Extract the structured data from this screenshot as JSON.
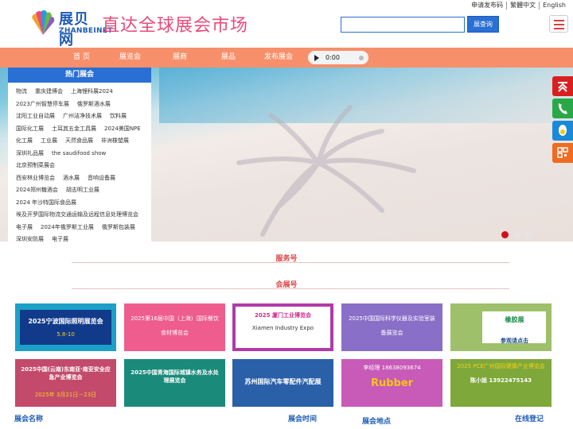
{
  "header": {
    "top_links": [
      "申请发布码",
      "繁體中文",
      "English"
    ],
    "logo_cn": "展贝网",
    "logo_en": "ZHANBEINET",
    "slogan": "直达全球展会市场",
    "search_placeholder": "",
    "search_button": "展查询"
  },
  "nav": {
    "items": [
      "首 页",
      "展览会",
      "展商",
      "展品",
      "发布展会"
    ],
    "audio_time": "0:00"
  },
  "hot_expos": {
    "title": "热门展会",
    "rows": [
      [
        "物流",
        "重庆建博会",
        "上海锂科展2024"
      ],
      [
        "2023广州智慧停车展",
        "俄罗斯酒水展"
      ],
      [
        "沈阳工业自动展",
        "广州洁净技术展",
        "饮料展"
      ],
      [
        "国际化工展",
        "土耳其五金工具展",
        "2024美国NPE"
      ],
      [
        "化工展",
        "工业展",
        "天然食品展",
        "非洲橡塑展"
      ],
      [
        "深圳礼品展",
        "the saudifood show",
        "北京预制菜展会"
      ],
      [
        "西安林业博览会",
        "酒水展",
        "音响设备展"
      ],
      [
        "2024郑州糖酒会",
        "胡志明工业展"
      ],
      [
        "2024 年沙特国际食品展"
      ],
      [
        "埃及开罗国际物流交通运输及远程信息处理博览会"
      ],
      [
        "电子展",
        "2024年俄罗斯工业展",
        "俄罗斯包装展"
      ],
      [
        "深圳安防展",
        "电子展"
      ]
    ]
  },
  "sections": {
    "service": "服务号",
    "expo": "会展号"
  },
  "cards_row1": [
    {
      "text": "2025宁波国际照明展览会",
      "sub": "5.8-10",
      "bg": "#1da0c8"
    },
    {
      "text": "2025第16届中国（上海）国际餐饮食材博览会",
      "bg": "#ee5d8d"
    },
    {
      "text": "2025 厦门工业博览会",
      "sub": "Xiamen Industry Expo",
      "bg": "#b03aa8"
    },
    {
      "text": "2025中国国际科学仪器及实验室装备展览会",
      "bg": "#8a6fc8"
    },
    {
      "text": "橡胶展",
      "sub": "参观请点击",
      "bg": "#9ec06a"
    }
  ],
  "cards_row2": [
    {
      "text": "2025中国(云南)东南亚·南亚安全应急产业博览会",
      "sub": "2025年 3月21日－23日",
      "bg": "#c34a6a"
    },
    {
      "text": "2025中国青海国际城镇水务及水处理展览会",
      "bg": "#1a8a7a"
    },
    {
      "text": "苏州国际汽车零配件汽配展",
      "bg": "#2a60a8"
    },
    {
      "text": "Rubber",
      "sub": "李经理 18638093674",
      "bg": "#c85ab8"
    },
    {
      "text": "2025 PCE广州国际健康产业博览会",
      "sub": "陈小姐 13922475143",
      "bg": "#7ea83a"
    }
  ],
  "bottom": {
    "name": "展会名称",
    "time": "展会时间",
    "place": "展会地点",
    "register": "在线登记"
  },
  "colors": {
    "nav": "#f7906a",
    "brand": "#2a6fd4",
    "accent": "#e04040",
    "slogan": "#e84b7c"
  }
}
